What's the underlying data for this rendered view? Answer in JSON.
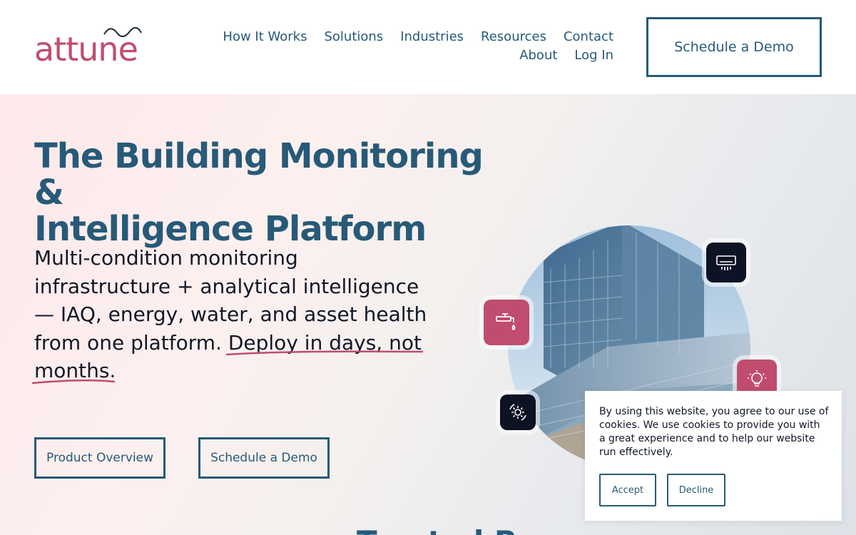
{
  "brand": {
    "name": "attune",
    "color": "#c04d6d"
  },
  "nav": {
    "row1": [
      "How It Works",
      "Solutions",
      "Industries",
      "Resources",
      "Contact"
    ],
    "row2": [
      "About",
      "Log In"
    ],
    "cta": "Schedule a Demo"
  },
  "hero": {
    "title_line1": "The Building Monitoring &",
    "title_line2": "Intelligence Platform",
    "lede_part1": "Multi-condition monitoring infrastructure + analytical intelligence — IAQ, energy, water, and asset health from one platform. ",
    "lede_highlight": "Deploy in days, not months.",
    "buttons": {
      "product_overview": "Product Overview",
      "schedule_demo": "Schedule a Demo"
    },
    "icons": [
      "faucet-icon",
      "air-conditioner-icon",
      "lightbulb-icon",
      "gear-icon"
    ]
  },
  "trusted_heading": "Trusted B",
  "cookie": {
    "text": "By using this website, you agree to our use of cookies. We use cookies to provide you with a great experience and to help our website run effectively.",
    "accept": "Accept",
    "decline": "Decline"
  },
  "colors": {
    "primary": "#275a78",
    "accent": "#c04d6d",
    "dark_tile": "#0d1224"
  }
}
